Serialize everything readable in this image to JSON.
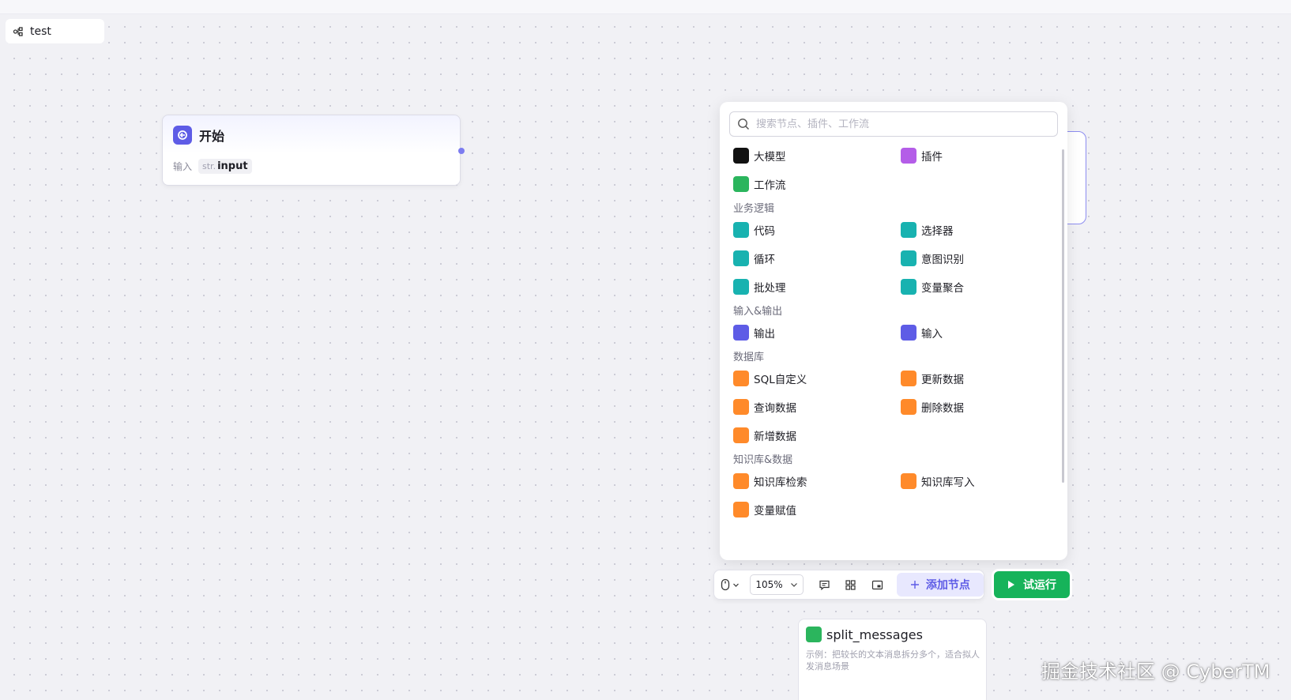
{
  "workflow": {
    "name": "test"
  },
  "start_node": {
    "title": "开始",
    "io_label": "输入",
    "param_type": "str.",
    "param_name": "input"
  },
  "node_panel": {
    "search_placeholder": "搜索节点、插件、工作流",
    "top_items": [
      {
        "label": "大模型",
        "icon": "llm-icon",
        "color": "#111111"
      },
      {
        "label": "插件",
        "icon": "plugin-icon",
        "color": "#b45de8"
      },
      {
        "label": "工作流",
        "icon": "workflow-icon",
        "color": "#2bb55d"
      }
    ],
    "sections": [
      {
        "title": "业务逻辑",
        "items": [
          {
            "label": "代码",
            "icon": "code-icon"
          },
          {
            "label": "选择器",
            "icon": "condition-icon"
          },
          {
            "label": "循环",
            "icon": "loop-icon"
          },
          {
            "label": "意图识别",
            "icon": "intent-icon"
          },
          {
            "label": "批处理",
            "icon": "batch-icon"
          },
          {
            "label": "变量聚合",
            "icon": "variable-merge-icon"
          }
        ]
      },
      {
        "title": "输入&输出",
        "items": [
          {
            "label": "输出",
            "icon": "output-icon"
          },
          {
            "label": "输入",
            "icon": "input-icon"
          }
        ]
      },
      {
        "title": "数据库",
        "items": [
          {
            "label": "SQL自定义",
            "icon": "database-sql-icon"
          },
          {
            "label": "更新数据",
            "icon": "database-update-icon"
          },
          {
            "label": "查询数据",
            "icon": "database-query-icon"
          },
          {
            "label": "删除数据",
            "icon": "database-delete-icon"
          },
          {
            "label": "新增数据",
            "icon": "database-insert-icon"
          }
        ]
      },
      {
        "title": "知识库&数据",
        "items": [
          {
            "label": "知识库检索",
            "icon": "knowledge-search-icon"
          },
          {
            "label": "知识库写入",
            "icon": "knowledge-write-icon"
          },
          {
            "label": "变量赋值",
            "icon": "variable-assign-icon"
          }
        ]
      }
    ]
  },
  "toolbar": {
    "zoom": "105%",
    "add_node_label": "添加节点",
    "run_label": "试运行"
  },
  "workflow_card": {
    "name": "split_messages",
    "description": "示例：把较长的文本消息拆分多个，适合拟人发消息场景"
  },
  "watermark": "掘金技术社区 @ CyberTM",
  "colors": {
    "accent": "#5e5ce6",
    "run_green": "#16b35a",
    "logic_teal": "#18b2b0",
    "database_orange": "#ff8a2a"
  }
}
